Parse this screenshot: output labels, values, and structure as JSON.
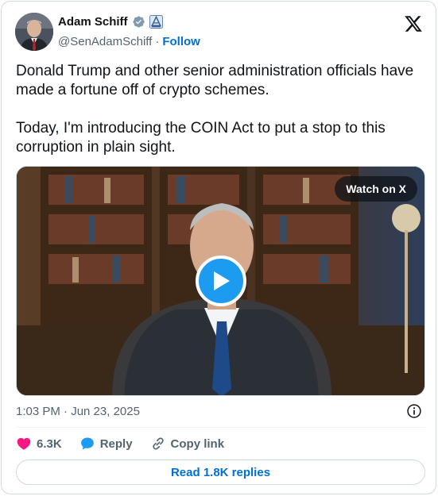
{
  "author": {
    "display_name": "Adam Schiff",
    "handle": "@SenAdamSchiff",
    "separator": "·",
    "follow_label": "Follow"
  },
  "tweet": {
    "text": "Donald Trump and other senior administration officials have made a fortune off of crypto schemes.\n\nToday, I'm introducing the COIN Act to put a stop to this corruption in plain sight."
  },
  "media": {
    "watch_label": "Watch on X"
  },
  "meta": {
    "timestamp": "1:03 PM · Jun 23, 2025"
  },
  "actions": {
    "like_count": "6.3K",
    "reply_label": "Reply",
    "copy_link_label": "Copy link"
  },
  "footer": {
    "read_replies_label": "Read 1.8K replies"
  },
  "colors": {
    "accent": "#1d9bf0",
    "link": "#006fd6",
    "like": "#f91880",
    "secondary_text": "#536471",
    "border": "#cfd9de"
  },
  "icons": {
    "logo": "x-logo-icon",
    "verified": "verified-badge-icon",
    "government": "government-badge-icon",
    "play": "play-icon",
    "info": "info-icon",
    "like": "heart-icon",
    "reply": "reply-bubble-icon",
    "copy_link": "link-icon"
  }
}
